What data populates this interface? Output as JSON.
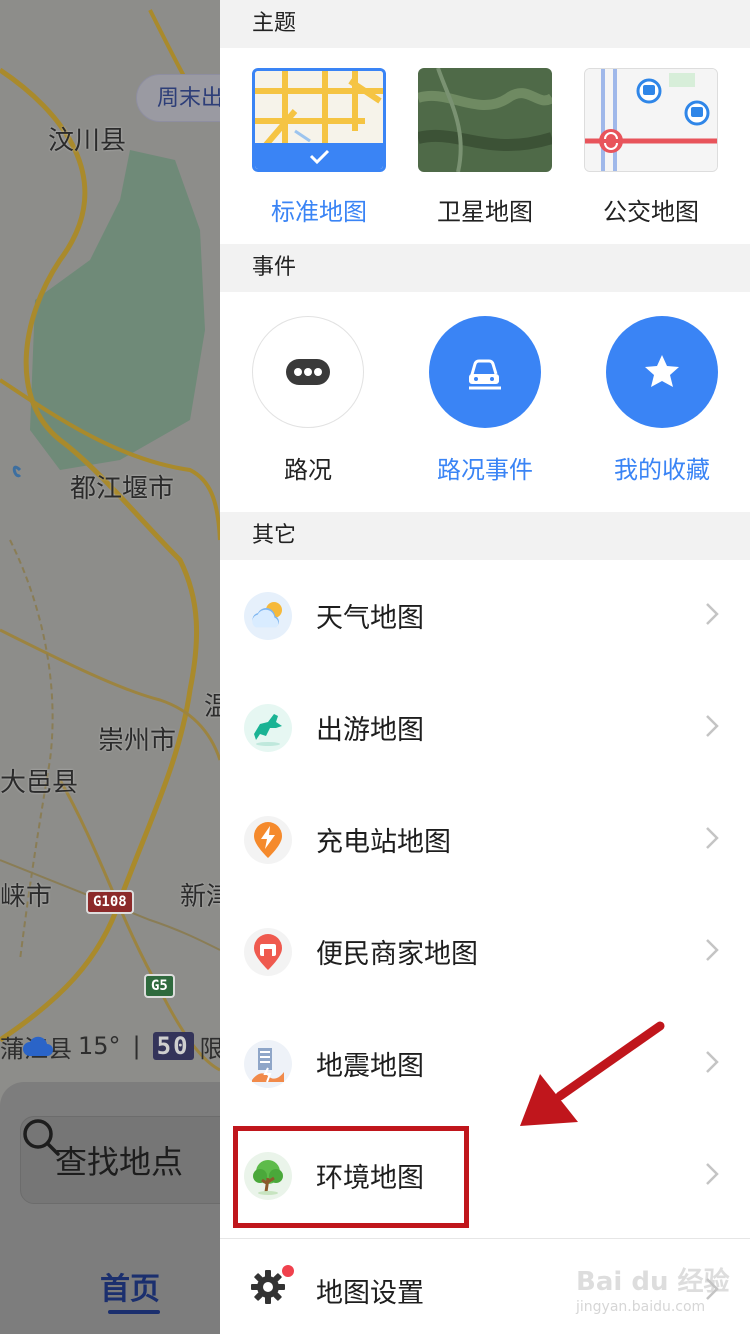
{
  "map": {
    "weekend_pill": "周末出",
    "places": {
      "wenchuan": "汶川县",
      "dujiangyan": "都江堰市",
      "chongzhou": "崇州市",
      "dayi": "大邑县",
      "xialai": "崃市",
      "xinjin": "新津",
      "pujiang": "蒲江县",
      "partial": "温"
    },
    "road_badges": {
      "g108": "G108",
      "g5": "G5"
    },
    "weather": {
      "temp": "15°",
      "divider": "|",
      "speed_limit": "50",
      "limit_label": "限"
    },
    "search_placeholder": "查找地点",
    "tab_home": "首页"
  },
  "drawer": {
    "theme": {
      "header": "主题",
      "cards": [
        {
          "label": "标准地图",
          "selected": true
        },
        {
          "label": "卫星地图",
          "selected": false
        },
        {
          "label": "公交地图",
          "selected": false
        }
      ]
    },
    "events": {
      "header": "事件",
      "items": [
        {
          "label": "路况",
          "icon": "more-dots-icon",
          "style": "outline"
        },
        {
          "label": "路况事件",
          "icon": "car-crash-icon",
          "style": "filled"
        },
        {
          "label": "我的收藏",
          "icon": "star-icon",
          "style": "filled"
        }
      ]
    },
    "other": {
      "header": "其它",
      "items": [
        {
          "label": "天气地图",
          "icon": "weather-cloud-sun-icon"
        },
        {
          "label": "出游地图",
          "icon": "horse-icon"
        },
        {
          "label": "充电站地图",
          "icon": "charging-bolt-icon"
        },
        {
          "label": "便民商家地图",
          "icon": "shop-icon"
        },
        {
          "label": "地震地图",
          "icon": "earthquake-icon"
        },
        {
          "label": "环境地图",
          "icon": "tree-icon"
        }
      ]
    },
    "settings": {
      "label": "地图设置",
      "icon": "gear-icon",
      "has_notification_dot": true
    },
    "watermark": {
      "main": "Bai du 经验",
      "sub": "jingyan.baidu.com"
    }
  },
  "colors": {
    "accent_blue": "#3a84f5",
    "annotation_red": "#c0161c",
    "notification_red": "#f0414d"
  }
}
